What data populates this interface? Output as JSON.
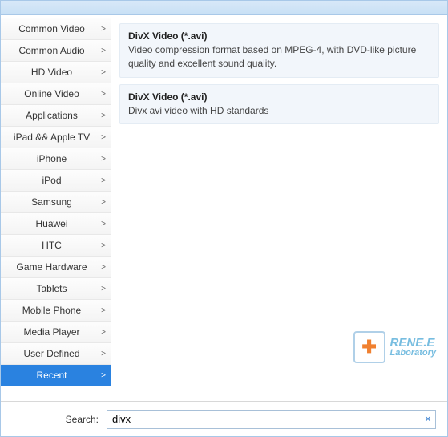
{
  "sidebar": {
    "items": [
      {
        "label": "Common Video"
      },
      {
        "label": "Common Audio"
      },
      {
        "label": "HD Video"
      },
      {
        "label": "Online Video"
      },
      {
        "label": "Applications"
      },
      {
        "label": "iPad && Apple TV"
      },
      {
        "label": "iPhone"
      },
      {
        "label": "iPod"
      },
      {
        "label": "Samsung"
      },
      {
        "label": "Huawei"
      },
      {
        "label": "HTC"
      },
      {
        "label": "Game Hardware"
      },
      {
        "label": "Tablets"
      },
      {
        "label": "Mobile Phone"
      },
      {
        "label": "Media Player"
      },
      {
        "label": "User Defined"
      },
      {
        "label": "Recent"
      }
    ],
    "active_index": 16,
    "chevron": ">"
  },
  "results": [
    {
      "title": "DivX Video (*.avi)",
      "desc": "Video compression format based on MPEG-4, with DVD-like picture quality and excellent sound quality."
    },
    {
      "title": "DivX Video (*.avi)",
      "desc": "Divx avi video with HD standards"
    }
  ],
  "search": {
    "label": "Search:",
    "value": "divx",
    "clear": "×"
  },
  "branding": {
    "name": "RENE.E",
    "sub": "Laboratory",
    "cross": "✚"
  }
}
